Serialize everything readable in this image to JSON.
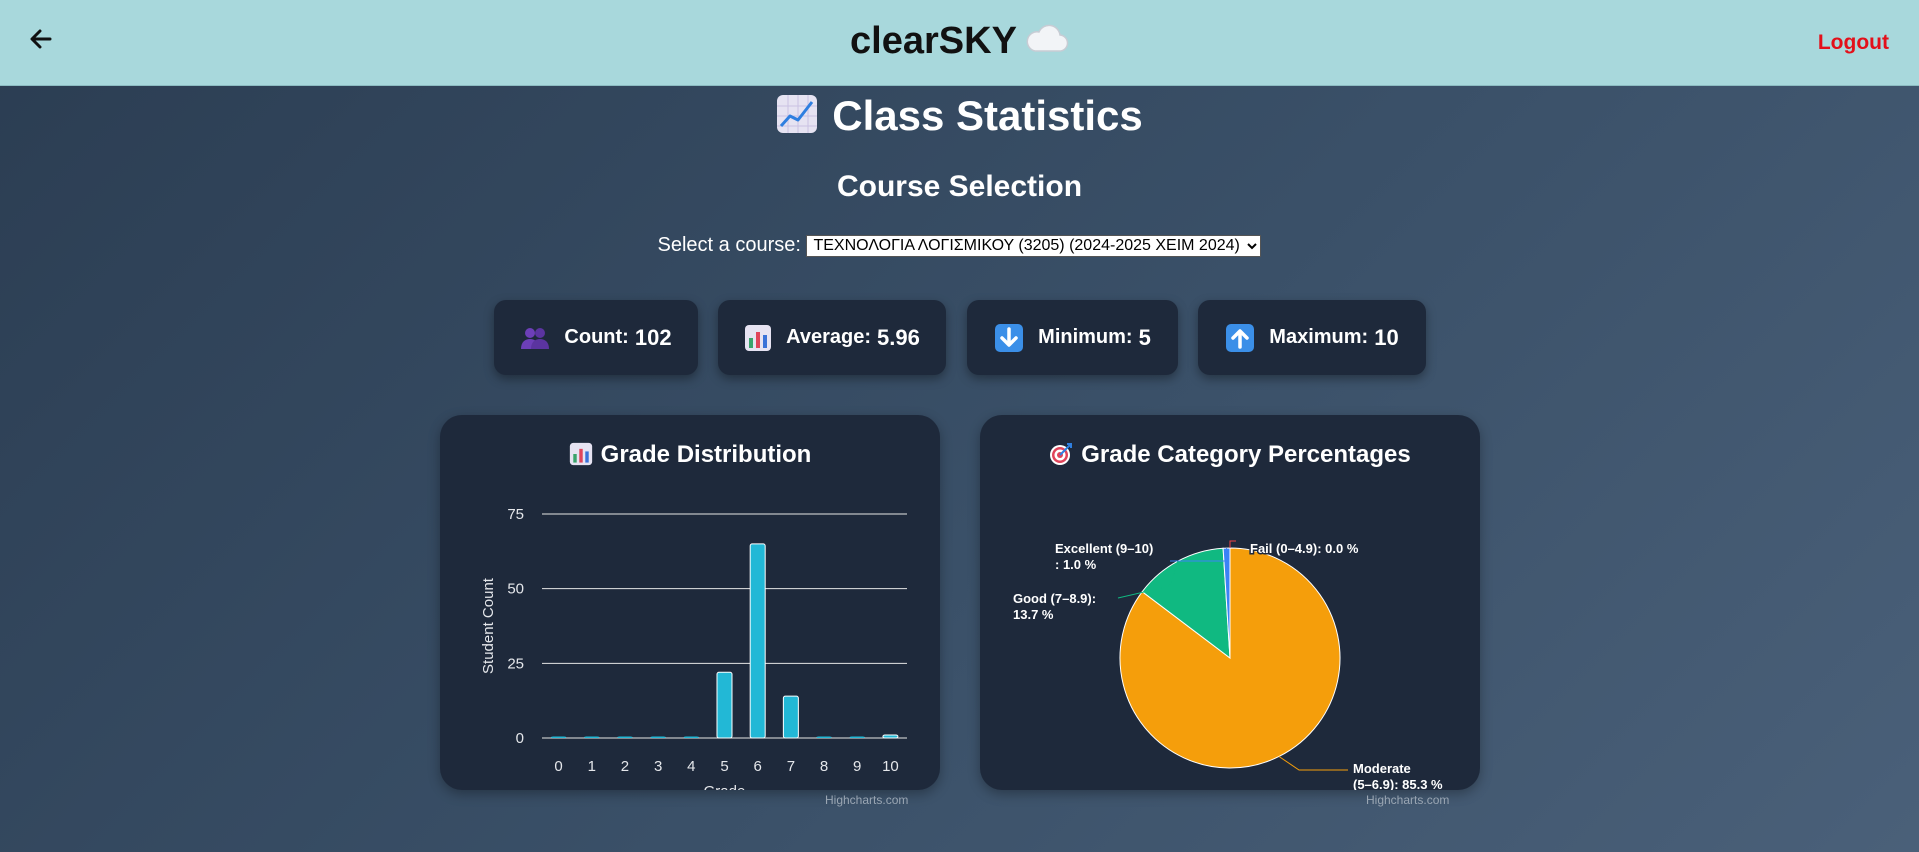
{
  "header": {
    "brand": "clearSKY",
    "logout_label": "Logout"
  },
  "page_title": "Class Statistics",
  "course_selection": {
    "title": "Course Selection",
    "label": "Select a course:",
    "selected": "ΤΕΧΝΟΛΟΓΙΑ ΛΟΓΙΣΜΙΚΟΥ (3205) (2024-2025 ΧΕΙΜ 2024)"
  },
  "stats": {
    "count": {
      "label": "Count:",
      "value": "102"
    },
    "average": {
      "label": "Average:",
      "value": "5.96"
    },
    "minimum": {
      "label": "Minimum:",
      "value": "5"
    },
    "maximum": {
      "label": "Maximum:",
      "value": "10"
    }
  },
  "distribution_card": {
    "title": "Grade Distribution",
    "credits": "Highcharts.com"
  },
  "category_card": {
    "title": "Grade Category Percentages",
    "credits": "Highcharts.com"
  },
  "colors": {
    "bar": "#22b8d6",
    "moderate": "#f59e0b",
    "good": "#10b981",
    "excellent": "#3b82f6",
    "fail": "#ef4444"
  },
  "chart_data": [
    {
      "type": "bar",
      "categories": [
        "0",
        "1",
        "2",
        "3",
        "4",
        "5",
        "6",
        "7",
        "8",
        "9",
        "10"
      ],
      "values": [
        0,
        0,
        0,
        0,
        0,
        22,
        65,
        14,
        0,
        0,
        1
      ],
      "xlabel": "Grade",
      "ylabel": "Student Count",
      "ylim": [
        0,
        75
      ],
      "yticks": [
        "0",
        "25",
        "50",
        "75"
      ],
      "grid": true
    },
    {
      "type": "pie",
      "slices": [
        {
          "label_line1": "Fail (0–4.9): 0.0 %",
          "label_line2": "",
          "value": 0.0,
          "color": "#ef4444"
        },
        {
          "label_line1": "Moderate",
          "label_line2": "(5–6.9): 85.3 %",
          "value": 85.3,
          "color": "#f59e0b"
        },
        {
          "label_line1": "Good (7–8.9):",
          "label_line2": "13.7 %",
          "value": 13.7,
          "color": "#10b981"
        },
        {
          "label_line1": "Excellent (9–10)",
          "label_line2": ": 1.0 %",
          "value": 1.0,
          "color": "#3b82f6"
        }
      ]
    }
  ]
}
